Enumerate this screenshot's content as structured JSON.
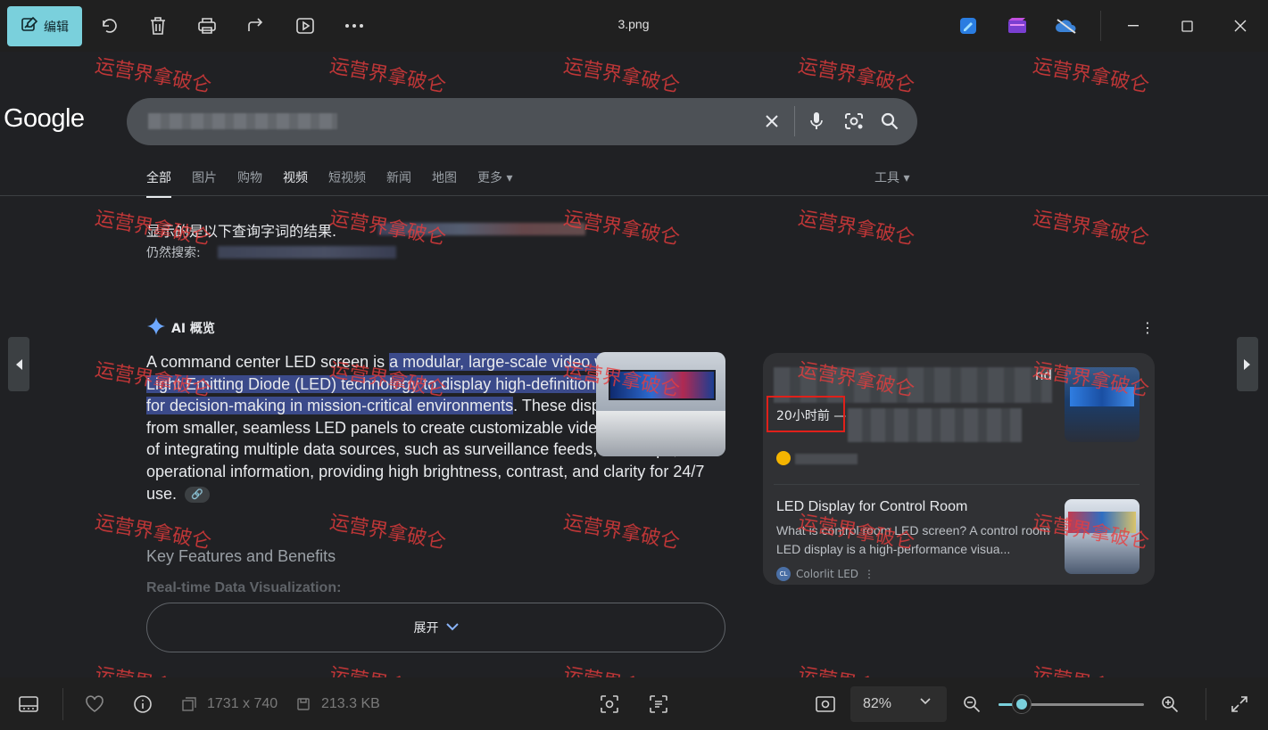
{
  "window": {
    "edit_label": "编辑",
    "file_title": "3.png"
  },
  "google": {
    "logo": "Google",
    "search": {
      "placeholder": ""
    },
    "tabs": [
      {
        "label": "全部",
        "state": "active"
      },
      {
        "label": "图片"
      },
      {
        "label": "购物"
      },
      {
        "label": "视频",
        "state": "bold"
      },
      {
        "label": "短视频"
      },
      {
        "label": "新闻"
      },
      {
        "label": "地图"
      },
      {
        "label": "更多 ▾"
      }
    ],
    "tools": "工具 ▾",
    "spell": {
      "line1": "显示的是以下查询字词的结果.",
      "line2": "仍然搜索:"
    }
  },
  "ai_overview": {
    "header": "AI 概览",
    "text_before": "A command center LED screen is ",
    "text_highlight": "a modular, large-scale video wall that uses Light Emitting Diode (LED) technology to display high-definition, real-time data for decision-making in mission-critical environments",
    "text_after": ". These displays are built from smaller, seamless LED panels to create customizable video walls capable of integrating multiple data sources, such as surveillance feeds, GIS maps, and operational information, providing high brightness, contrast, and clarity for 24/7 use.",
    "section_heading": "Key Features and Benefits",
    "faded_subheading": "Real-time Data Visualization:",
    "expand_label": "展开"
  },
  "sources": {
    "card1": {
      "title_tail": "nd",
      "time": "20小时前 —",
      "desc_tail": "i"
    },
    "card2": {
      "title": "LED Display for Control Room",
      "desc": "What is control room LED screen? A control room LED display is a high-performance visua...",
      "source": "Colorlit LED",
      "logo_text": "CL"
    }
  },
  "watermark": "运营界拿破仑",
  "statusbar": {
    "dimensions": "1731 x 740",
    "filesize": "213.3 KB",
    "zoom": "82%",
    "zoom_level": 0.16
  },
  "colors": {
    "accent": "#7ad0dc",
    "highlight": "#3b4a8a",
    "red_box": "#e0201a",
    "watermark": "#eb3c3c"
  }
}
